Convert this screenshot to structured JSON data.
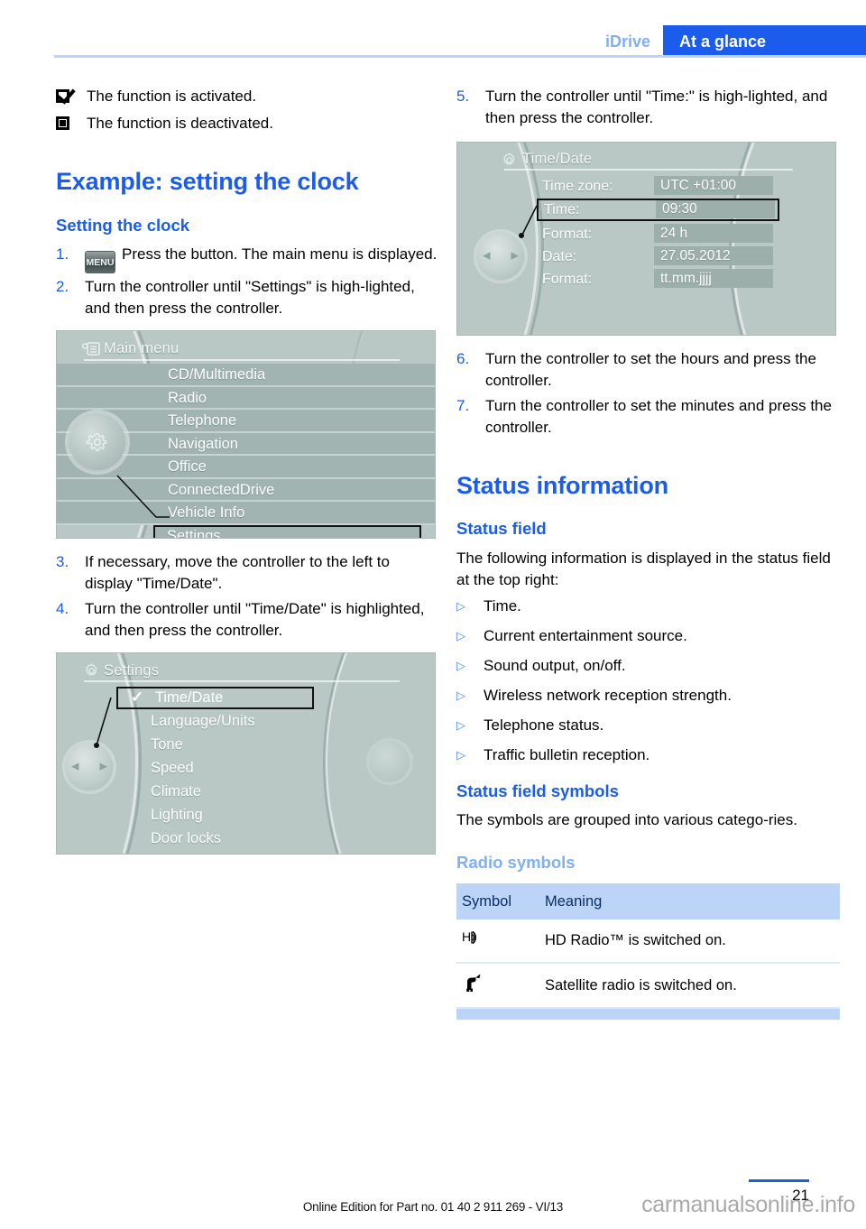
{
  "header": {
    "tab_idrive": "iDrive",
    "tab_current": "At a glance",
    "accent_blue": "#1b5ced",
    "light_blue": "#7fb0f5"
  },
  "legend": [
    {
      "icon": "checkbox-checked-icon",
      "text": "The function is activated."
    },
    {
      "icon": "checkbox-filled-icon",
      "text": "The function is deactivated."
    }
  ],
  "left_column": {
    "section_title": "Example: setting the clock",
    "subsection_title": "Setting the clock",
    "steps": [
      {
        "num": "1.",
        "button": "MENU",
        "text": "Press the button. The main menu is displayed."
      },
      {
        "num": "2.",
        "text": "Turn the controller until \"Settings\" is high‑lighted, and then press the controller."
      },
      {
        "num": "3.",
        "text": "If necessary, move the controller to the left to display \"Time/Date\"."
      },
      {
        "num": "4.",
        "text": "Turn the controller until \"Time/Date\" is highlighted, and then press the controller."
      }
    ],
    "main_menu_screen": {
      "title": "Main menu",
      "icon": "list-icon",
      "items": [
        {
          "label": "CD/Multimedia",
          "selected": false
        },
        {
          "label": "Radio",
          "selected": false
        },
        {
          "label": "Telephone",
          "selected": false
        },
        {
          "label": "Navigation",
          "selected": false
        },
        {
          "label": "Office",
          "selected": false
        },
        {
          "label": "ConnectedDrive",
          "selected": false
        },
        {
          "label": "Vehicle Info",
          "selected": false
        },
        {
          "label": "Settings",
          "selected": true
        }
      ]
    },
    "settings_screen": {
      "title": "Settings",
      "icon": "gear-icon",
      "items": [
        {
          "label": "Time/Date",
          "selected": true,
          "check": "✓"
        },
        {
          "label": "Language/Units",
          "selected": false
        },
        {
          "label": "Tone",
          "selected": false
        },
        {
          "label": "Speed",
          "selected": false
        },
        {
          "label": "Climate",
          "selected": false
        },
        {
          "label": "Lighting",
          "selected": false
        },
        {
          "label": "Door locks",
          "selected": false
        }
      ]
    }
  },
  "right_column": {
    "steps": [
      {
        "num": "5.",
        "text": "Turn the controller until \"Time:\" is high‑lighted, and then press the controller."
      },
      {
        "num": "6.",
        "text": "Turn the controller to set the hours and press the controller."
      },
      {
        "num": "7.",
        "text": "Turn the controller to set the minutes and press the controller."
      }
    ],
    "timedate_screen": {
      "title": "Time/Date",
      "icon": "gear-icon",
      "rows": [
        {
          "label": "Time zone:",
          "value": "UTC +01:00",
          "selected": false
        },
        {
          "label": "Time:",
          "value": "09:30",
          "selected": true
        },
        {
          "label": "Format:",
          "value": "24 h",
          "selected": false
        },
        {
          "label": "Date:",
          "value": "27.05.2012",
          "selected": false
        },
        {
          "label": "Format:",
          "value": "tt.mm.jjjj",
          "selected": false
        }
      ]
    },
    "status_section_title": "Status information",
    "status_field_title": "Status field",
    "status_field_intro": "The following information is displayed in the status field at the top right:",
    "status_field_bullets": [
      "Time.",
      "Current entertainment source.",
      "Sound output, on/off.",
      "Wireless network reception strength.",
      "Telephone status.",
      "Traffic bulletin reception."
    ],
    "status_symbols_title": "Status field symbols",
    "status_symbols_intro": "The symbols are grouped into various catego‑ries.",
    "radio_symbols_title": "Radio symbols",
    "symbol_table": {
      "columns": [
        "Symbol",
        "Meaning"
      ],
      "rows": [
        {
          "symbol": "hd-radio-icon",
          "symbol_glyph": "Hʙ)",
          "meaning": "HD Radio™ is switched on."
        },
        {
          "symbol": "satellite-radio-icon",
          "symbol_glyph": "὎1",
          "meaning": "Satellite radio is switched on."
        }
      ]
    }
  },
  "footer": {
    "edition_text": "Online Edition for Part no. 01 40 2 911 269 - VI/13",
    "page_number": "21",
    "watermark": "carmanualsonline.info"
  }
}
